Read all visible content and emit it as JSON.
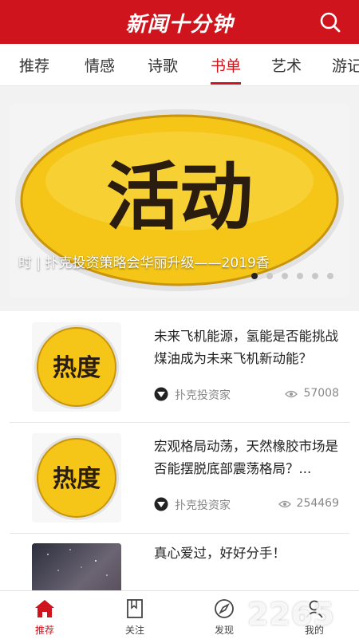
{
  "app": {
    "title": "新闻十分钟"
  },
  "tabs": [
    {
      "label": "推荐",
      "active": false
    },
    {
      "label": "情感",
      "active": false
    },
    {
      "label": "诗歌",
      "active": false
    },
    {
      "label": "书单",
      "active": true
    },
    {
      "label": "艺术",
      "active": false
    },
    {
      "label": "游记",
      "active": false
    }
  ],
  "banner": {
    "image_text": "活动",
    "caption": "时 | 扑克投资策略会华丽升级——2019香",
    "slide_count": 6,
    "active_slide": 1
  },
  "feed": [
    {
      "thumb_text": "热度",
      "title": "未来飞机能源，氢能是否能挑战煤油成为未来飞机新动能？",
      "source": "扑克投资家",
      "views": "57008"
    },
    {
      "thumb_text": "热度",
      "title": "宏观格局动荡，天然橡胶市场是否能摆脱底部震荡格局？...",
      "source": "扑克投资家",
      "views": "254469"
    },
    {
      "thumb_text": "",
      "title": "真心爱过，好好分手！",
      "source": "",
      "views": ""
    }
  ],
  "bottom_nav": [
    {
      "label": "推荐",
      "icon": "home-icon",
      "active": true
    },
    {
      "label": "关注",
      "icon": "bookmark-icon",
      "active": false
    },
    {
      "label": "发现",
      "icon": "compass-icon",
      "active": false
    },
    {
      "label": "我的",
      "icon": "user-icon",
      "active": false
    }
  ],
  "watermark": {
    "text": "2265"
  },
  "colors": {
    "brand_red": "#d0141d",
    "badge_yellow": "#f5c518"
  }
}
